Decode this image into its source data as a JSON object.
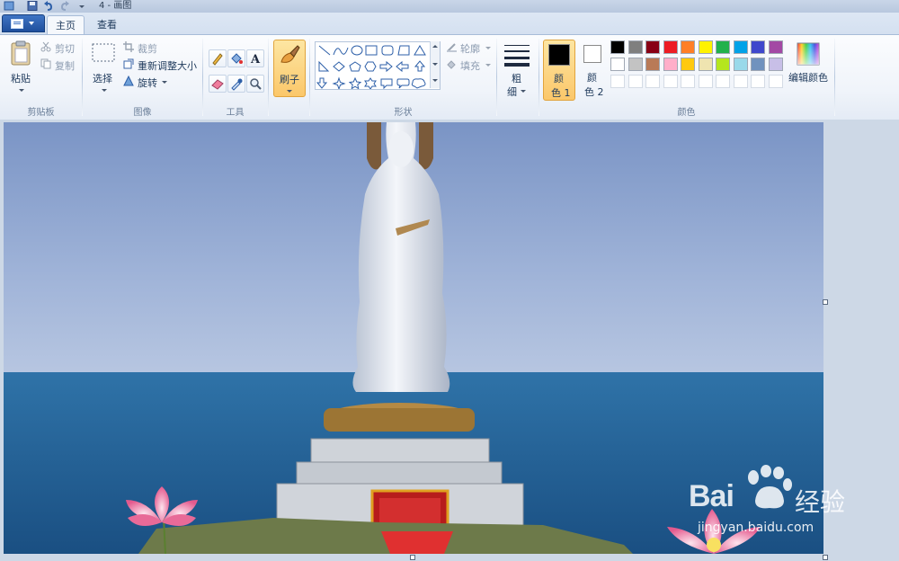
{
  "window": {
    "title": "4 - 画图"
  },
  "tabs": [
    {
      "label": "主页",
      "active": true
    },
    {
      "label": "查看",
      "active": false
    }
  ],
  "clipboard": {
    "paste_label": "粘贴",
    "cut_label": "剪切",
    "copy_label": "复制",
    "group_label": "剪贴板"
  },
  "image": {
    "select_label": "选择",
    "crop_label": "裁剪",
    "resize_label": "重新调整大小",
    "rotate_label": "旋转",
    "group_label": "图像"
  },
  "tools": {
    "group_label": "工具"
  },
  "brushes": {
    "label": "刷子"
  },
  "shapes": {
    "outline_label": "轮廓",
    "fill_label": "填充",
    "group_label": "形状"
  },
  "size": {
    "label_line1": "粗",
    "label_line2": "细"
  },
  "colors": {
    "color1_line1": "颜",
    "color1_line2": "色 1",
    "color2_line1": "颜",
    "color2_line2": "色 2",
    "edit_label": "编辑颜色",
    "group_label": "颜色",
    "color1_value": "#000000",
    "color2_value": "#ffffff",
    "palette_row1": [
      "#000000",
      "#7f7f7f",
      "#880015",
      "#ed1c24",
      "#ff7f27",
      "#fff200",
      "#22b14c",
      "#00a2e8",
      "#3f48cc",
      "#a349a4"
    ],
    "palette_row2": [
      "#ffffff",
      "#c3c3c3",
      "#b97a57",
      "#ffaec9",
      "#ffc90e",
      "#efe4b0",
      "#b5e61d",
      "#99d9ea",
      "#7092be",
      "#c8bfe7"
    ]
  },
  "watermark": {
    "brand": "Bai",
    "brand_suffix": "经验",
    "url": "jingyan.baidu.com"
  }
}
